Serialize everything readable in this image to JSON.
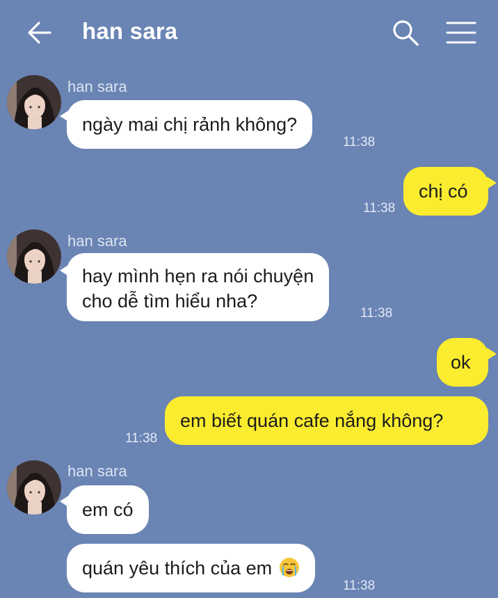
{
  "header": {
    "title": "han sara",
    "back_icon": "arrow-left-icon",
    "search_icon": "search-icon",
    "menu_icon": "hamburger-menu-icon"
  },
  "colors": {
    "background": "#6a84b4",
    "incoming_bubble": "#ffffff",
    "outgoing_bubble": "#fbec2f",
    "text": "#1c1c1c"
  },
  "messages": [
    {
      "direction": "in",
      "sender": "han sara",
      "lines": [
        "ngày mai chị rảnh không?"
      ],
      "time": "11:38"
    },
    {
      "direction": "out",
      "lines": [
        "chị có"
      ],
      "time": "11:38"
    },
    {
      "direction": "in",
      "sender": "han sara",
      "lines": [
        "hay mình hẹn ra nói chuyện",
        "cho dễ tìm hiểu nha?"
      ],
      "time": "11:38"
    },
    {
      "direction": "out",
      "lines": [
        "ok"
      ],
      "time": ""
    },
    {
      "direction": "out",
      "lines": [
        "em biết quán cafe nắng không?"
      ],
      "time": "11:38"
    },
    {
      "direction": "in",
      "sender": "han sara",
      "lines": [
        "em có"
      ],
      "time": ""
    },
    {
      "direction": "in",
      "lines": [
        "quán yêu thích của em"
      ],
      "emoji": "loudly-crying-face-icon",
      "time": "11:38"
    }
  ]
}
